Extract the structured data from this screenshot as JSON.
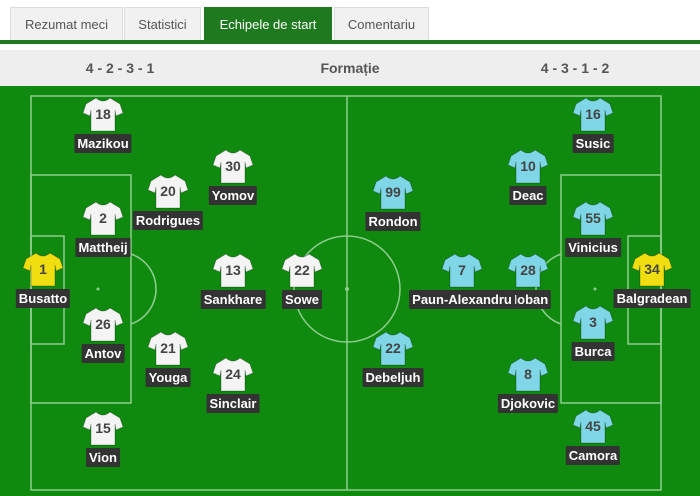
{
  "tabs": [
    {
      "label": "Rezumat meci"
    },
    {
      "label": "Statistici"
    },
    {
      "label": "Echipele de start"
    },
    {
      "label": "Comentariu"
    }
  ],
  "formation": {
    "home": "4 - 2 - 3 - 1",
    "label": "Formație",
    "away": "4 - 3 - 1 - 2"
  },
  "colors": {
    "pitch": "#0f8a0f",
    "home_shirt": "#f4f4f4",
    "home_gk_shirt": "#f0de10",
    "away_shirt": "#7fd6e6",
    "away_gk_shirt": "#f0de10",
    "active_tab": "#1f7a1f"
  },
  "home_players": [
    {
      "number": "1",
      "name": "Busatto",
      "gk": true
    },
    {
      "number": "18",
      "name": "Mazikou"
    },
    {
      "number": "2",
      "name": "Mattheij"
    },
    {
      "number": "26",
      "name": "Antov"
    },
    {
      "number": "15",
      "name": "Vion"
    },
    {
      "number": "20",
      "name": "Rodrigues"
    },
    {
      "number": "21",
      "name": "Youga"
    },
    {
      "number": "30",
      "name": "Yomov"
    },
    {
      "number": "13",
      "name": "Sankhare"
    },
    {
      "number": "24",
      "name": "Sinclair"
    },
    {
      "number": "22",
      "name": "Sowe"
    }
  ],
  "away_players": [
    {
      "number": "34",
      "name": "Balgradean",
      "gk": true
    },
    {
      "number": "16",
      "name": "Susic"
    },
    {
      "number": "55",
      "name": "Vinicius"
    },
    {
      "number": "3",
      "name": "Burca"
    },
    {
      "number": "45",
      "name": "Camora"
    },
    {
      "number": "10",
      "name": "Deac"
    },
    {
      "number": "28",
      "name": "Hoban"
    },
    {
      "number": "8",
      "name": "Djokovic"
    },
    {
      "number": "7",
      "name": "Paun-Alexandru"
    },
    {
      "number": "99",
      "name": "Rondon"
    },
    {
      "number": "22",
      "name": "Debeljuh"
    }
  ]
}
